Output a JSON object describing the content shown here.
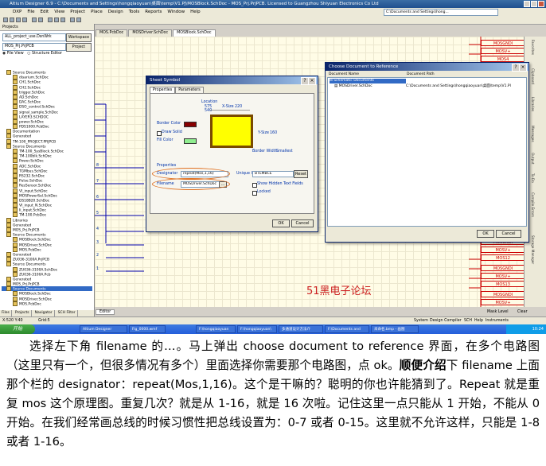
{
  "window": {
    "title": "Altium Designer 6.9 - C:\\Documents and Settings\\hongqiaoyuan\\桌面\\temp\\V1.PJ\\MOSBlock.SchDoc - MOS_Prj.PrjPCB. Licensed to Guangzhou Shiyuan Electronics Co Ltd",
    "path": "C:\\Documents and Settings\\hong..."
  },
  "menu": [
    "DXP",
    "File",
    "Edit",
    "View",
    "Project",
    "Place",
    "Design",
    "Tools",
    "Reports",
    "Window",
    "Help"
  ],
  "doc_tabs": [
    "MOS.PcbDoc",
    "MOSDriver.SchDoc",
    "MOSBlock.SchDoc"
  ],
  "left_panel": {
    "header": "Projects",
    "combo_value": "ALL_project_use.DsnWrk",
    "workspace_btn": "Workspace",
    "project_value": "MOS_Prj.PrjPCB",
    "project_btn": "Project",
    "view_opt_file": "File View",
    "view_opt_struct": "Structure Editor",
    "tree": [
      "Source Documents",
      "disarium.SchDoc",
      "CH1.SchDoc",
      "CH2.SchDoc",
      "trigger.SchDoc",
      "AD.SchDoc",
      "DAC.SchDoc",
      "DSO_control.SchDoc",
      "signal_sample.SchDoc",
      "LAYER3.SCHDOC",
      "power.SchDoc",
      "PDS1000.PcbDoc",
      "Documentation",
      "Generated",
      "TM-100_PROJECT.PRJPCB",
      "Source Documents",
      "TM-100_SysBlock.SchDoc",
      "TM-100blk.SchDoc",
      "Power.SchDoc",
      "ADC.SchDoc",
      "TGMbus.SchDoc",
      "RS232.SchDoc",
      "Pulse.SchDoc",
      "ResSensor.SchDoc",
      "VI_input.SchDoc",
      "MOSPowerSel.SchDoc",
      "DS18B20.SchDoc",
      "VI_input_N.SchDoc",
      "Ii_input.SchDoc",
      "TM-100.PcbDoc",
      "Libraries",
      "Generated",
      "MOS_Prj.PrjPCB",
      "Source Documents",
      "MOSBlock.SchDoc",
      "MOSDriver.SchDoc",
      "MOS.PcbDoc",
      "Generated",
      "ZU036-3100A.PrjPCB",
      "Source Documents",
      "ZU036-3100A.SchDoc",
      "ZU036-3100A.Pcb",
      "Generated",
      "MOS_Prj.PrjPCB",
      "Source Documents",
      "MOSBlock.SchDoc",
      "MOSDriver.SchDoc",
      "MOS.PcbDoc"
    ],
    "bottom_tabs": [
      "Files",
      "Projects",
      "Navigator",
      "SCH Filter"
    ]
  },
  "canvas": {
    "watermark": "51黑电子论坛",
    "editor_tab": "Editor",
    "mos_labels_top": [
      "MOSGNDI",
      "MOSV+",
      "MOS4",
      "MOSGNDI",
      "MOSV+"
    ],
    "mos_labels_bottom": [
      "MOSGNDI",
      "MOSV+",
      "MOS12",
      "MOSGNDI",
      "MOSV+",
      "MOS13",
      "MOSGNDI",
      "MOSV+"
    ],
    "pin_numbers": [
      "8",
      "7",
      "6",
      "5",
      "4",
      "3",
      "2",
      "1"
    ]
  },
  "right_sidebar": [
    "Favorites",
    "Clipboard",
    "Libraries",
    "Messages",
    "Output",
    "To-Do",
    "Compile Errors",
    "Storage Manager"
  ],
  "sheet_symbol_dialog": {
    "title": "Sheet Symbol",
    "tabs": [
      "Properties",
      "Parameters"
    ],
    "location_label": "Location",
    "location_x": "575",
    "location_y": "540",
    "x_size_label": "X-Size",
    "x_size_value": "220",
    "y_size_label": "Y-Size",
    "y_size_value": "160",
    "border_color_label": "Border Color",
    "draw_solid_label": "Draw Solid",
    "fill_color_label": "Fill Color",
    "border_width_label": "Border Width",
    "border_width_value": "Smallest",
    "properties_label": "Properties",
    "designator_label": "Designator",
    "designator_value": "repeat(Mos,1,16)",
    "unique_id_label": "Unique Id",
    "unique_id_value": "BTEMBCE",
    "reset_btn": "Reset",
    "filename_label": "Filename",
    "filename_value": "MOSDriver.SchDoc",
    "show_hidden_label": "Show Hidden Text Fields",
    "locked_label": "Locked",
    "ok_btn": "OK",
    "cancel_btn": "Cancel",
    "colors": {
      "border": "#7a4a00",
      "border_swatch": "#880000",
      "fill": "#ffff00",
      "fill_swatch": "#90ee90"
    }
  },
  "choose_doc_dialog": {
    "title": "Choose Document to Reference",
    "col_doc": "Document Name",
    "col_path": "Document Path",
    "row1_name": "Schematic Documents",
    "row2_name": "MOSDriver.SchDoc",
    "row2_path": "C:\\Documents and Settings\\hongqiaoyuan\\桌面\\temp\\V1.Pl",
    "ok_btn": "OK",
    "cancel_btn": "Cancel"
  },
  "statusbar": {
    "coords": "X:520 Y:40",
    "grid": "Grid:5",
    "right_items": [
      "System",
      "Design Compiler",
      "SCH",
      "Help",
      "Instruments"
    ],
    "mask": "Mask Level",
    "clear": "Clear"
  },
  "taskbar": {
    "start": "开始",
    "tasks": [
      "Altium Designer",
      "Fig_0000.wmf",
      "F:\\hongqiaoyuan",
      "F:\\hongqiaoyuan\\",
      "多通道设计方法介",
      "F:\\Documents and",
      "未命名.bmp - 画图"
    ],
    "time": "10:24"
  },
  "article": {
    "p1a": "选择左下角 filename 的…。马上弹出 choose document to reference 界面，在多个电路图（这里只有一个，但很多情况有多个）里面选择你需要那个电路图，点 ok。",
    "p1b": "顺便介绍",
    "p1c": "下 filename 上面那个栏的 designator：repeat(Mos,1,16)。这个是干嘛的？聪明的你也许能猜到了。Repeat 就是重复 mos 这个原理图。重复几次？就是从 1-16，就是 16 次啦。记住这里一点只能从 1 开始，不能从 0 开始。在我们经常画总线的时候习惯性把总线设置为：0-7 或者 0-15。这里就不允许这样，只能是 1-8 或者 1-16。"
  }
}
